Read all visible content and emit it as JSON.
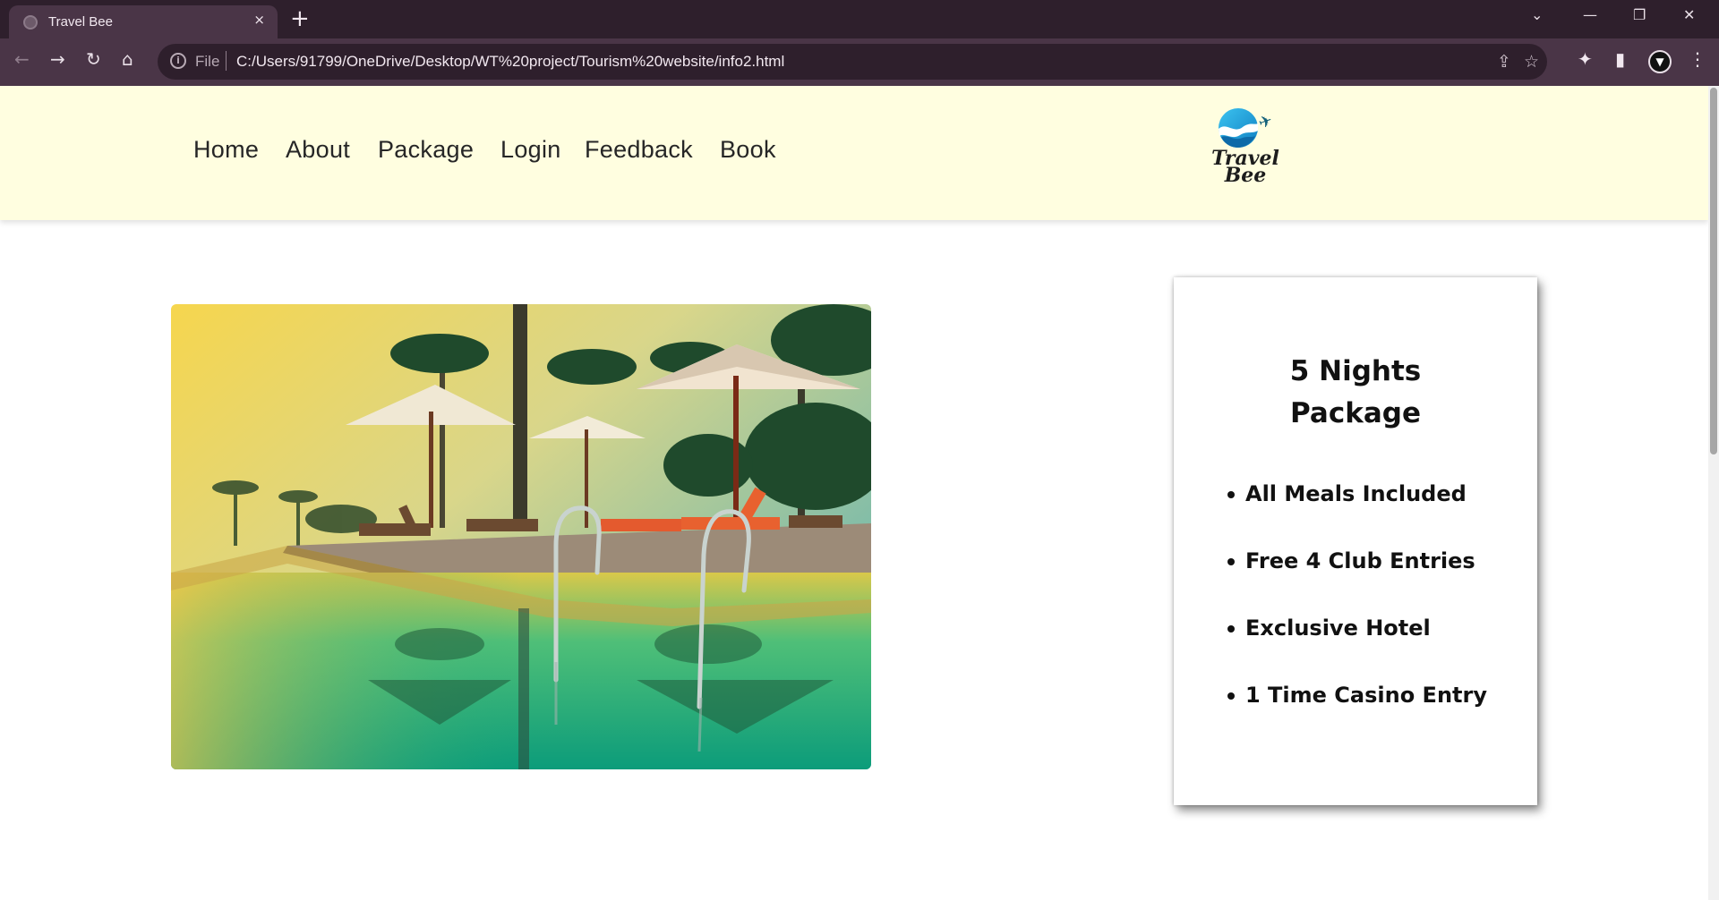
{
  "browser": {
    "tab_title": "Travel Bee",
    "tab_close_icon": "×",
    "new_tab_icon": "+",
    "address_scheme": "File",
    "address_url": "C:/Users/91799/OneDrive/Desktop/WT%20project/Tourism%20website/info2.html",
    "controls": {
      "chevron": "⌄",
      "minimize": "—",
      "restore": "❐",
      "close": "✕"
    },
    "nav": {
      "back": "←",
      "forward": "→",
      "reload": "↻",
      "home": "⌂"
    },
    "omni_icons": {
      "share": "⇪",
      "star": "☆"
    },
    "toolbar_icons": {
      "extensions": "✦",
      "sidepanel": "▮",
      "profile": "▼",
      "menu": "⋮"
    }
  },
  "site": {
    "nav": [
      "Home",
      "About",
      "Package",
      "Login",
      "Feedback",
      "Book"
    ],
    "logo": {
      "line1": "Travel",
      "line2": "Bee",
      "plane_icon": "✈"
    },
    "card": {
      "title_line1": "5 Nights",
      "title_line2": "Package",
      "features": [
        "All Meals Included",
        "Free 4 Club Entries",
        "Exclusive Hotel",
        "1 Time Casino Entry"
      ]
    }
  },
  "colors": {
    "chrome_dark": "#2e1f2c",
    "chrome_mid": "#4a3547",
    "header_bg": "#fffee0",
    "logo_blue": "#1aa6e0"
  }
}
